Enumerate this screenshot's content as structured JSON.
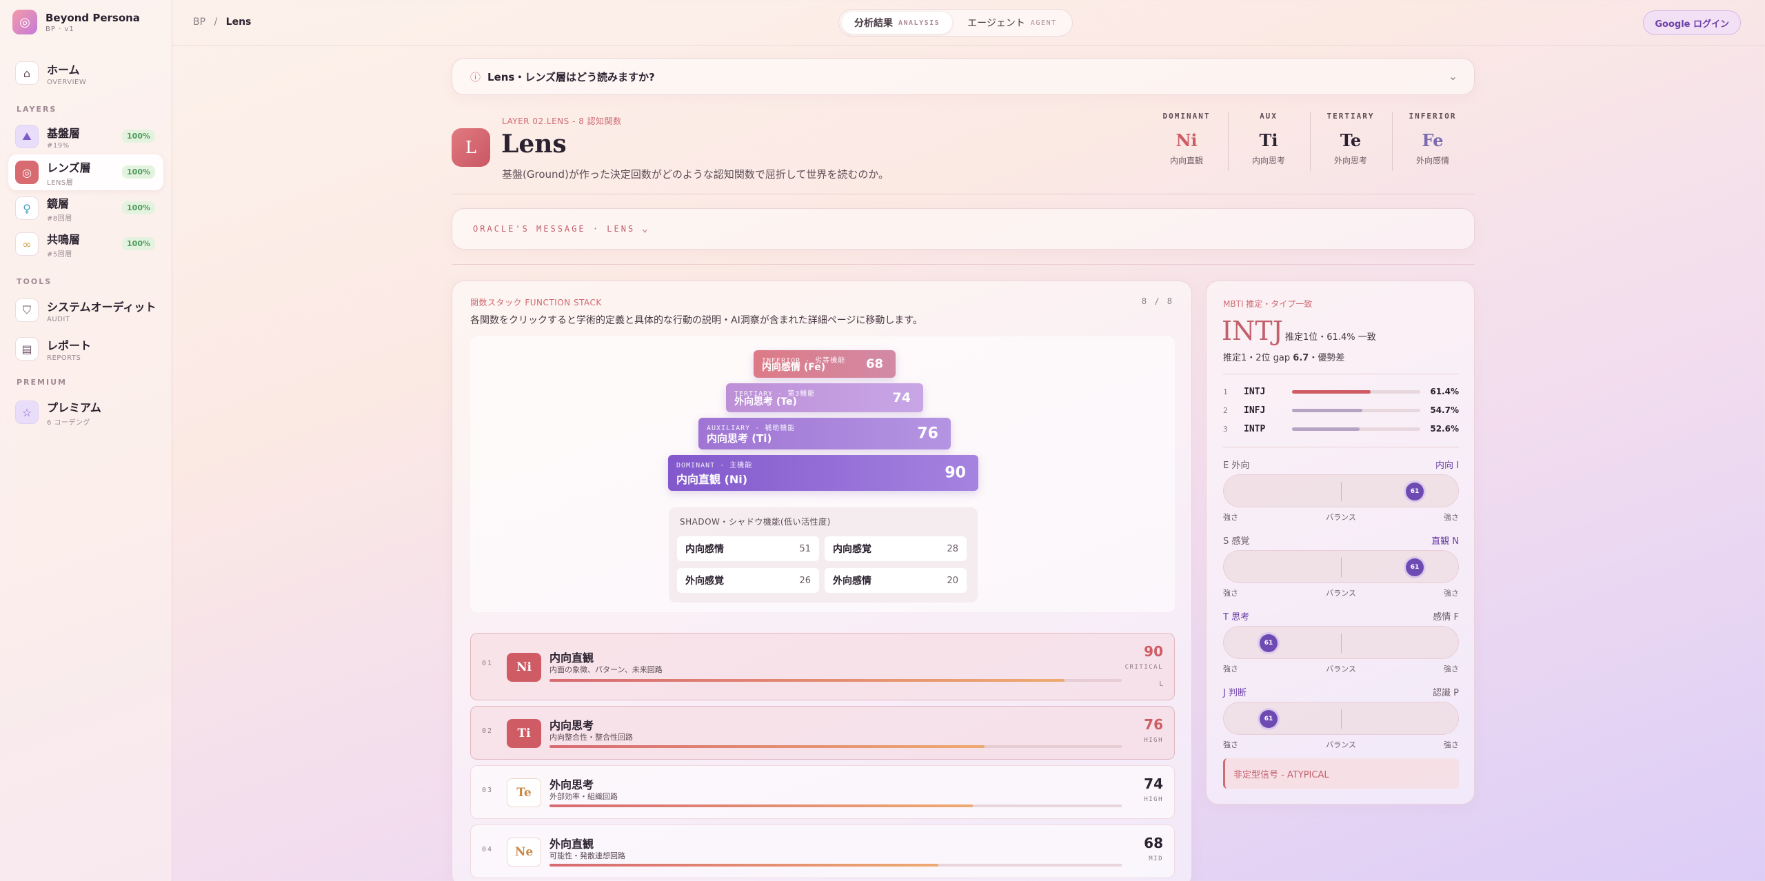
{
  "brand": {
    "name": "Beyond Persona",
    "sub": "BP · v1"
  },
  "breadcrumb": {
    "root": "BP",
    "sep": "/",
    "current": "Lens"
  },
  "segmented": [
    {
      "label": "分析結果",
      "en": "ANALYSIS"
    },
    {
      "label": "エージェント",
      "en": "AGENT"
    }
  ],
  "login_label": "Google ログイン",
  "sidebar": {
    "home": {
      "label": "ホーム",
      "sub": "OVERVIEW"
    },
    "layers_label": "LAYERS",
    "layers": [
      {
        "label": "基盤層",
        "sub": "#19%",
        "pct": "100%"
      },
      {
        "label": "レンズ層",
        "sub": "LENS層",
        "pct": "100%"
      },
      {
        "label": "鏡層",
        "sub": "#8回層",
        "pct": "100%"
      },
      {
        "label": "共鳴層",
        "sub": "#5回層",
        "pct": "100%"
      }
    ],
    "tools_label": "TOOLS",
    "tools": [
      {
        "label": "システムオーディット",
        "sub": "AUDIT"
      },
      {
        "label": "レポート",
        "sub": "REPORTS"
      }
    ],
    "premium_label": "PREMIUM",
    "premium": {
      "label": "プレミアム",
      "sub": "6 コーデング"
    }
  },
  "info_question": "Lens・レンズ層はどう読みますか?",
  "header": {
    "layer_label": "LAYER 02.LENS - 8 認知関数",
    "badge": "L",
    "title": "Lens",
    "desc": "基盤(Ground)が作った決定回数がどのような認知関数で屈折して世界を読むのか。",
    "stack": [
      {
        "role": "DOMINANT",
        "code": "Ni",
        "jp": "内向直観",
        "color": "#cf5c64"
      },
      {
        "role": "AUX",
        "code": "Ti",
        "jp": "内向思考",
        "color": "#2b2230"
      },
      {
        "role": "TERTIARY",
        "code": "Te",
        "jp": "外向思考",
        "color": "#2b2230"
      },
      {
        "role": "INFERIOR",
        "code": "Fe",
        "jp": "外向感情",
        "color": "#7b6bb0"
      }
    ]
  },
  "oracle_label": "ORACLE'S MESSAGE · LENS",
  "function_stack": {
    "title": "関数スタック FUNCTION STACK",
    "subtitle": "各関数をクリックすると学術的定義と具体的な行動の説明・AI洞察が含まれた詳細ページに移動します。",
    "count": "8 / 8",
    "pyramid": [
      {
        "role": "INFERIOR · 劣等機能",
        "name": "内向感情 (Fe)",
        "value": 68
      },
      {
        "role": "TERTIARY · 第3機能",
        "name": "外向思考 (Te)",
        "value": 74
      },
      {
        "role": "AUXILIARY · 補助機能",
        "name": "内向思考 (Ti)",
        "value": 76
      },
      {
        "role": "DOMINANT · 主機能",
        "name": "内向直観 (Ni)",
        "value": 90
      }
    ],
    "shadow": {
      "title": "SHADOW・シャドウ機能(低い活性度)",
      "cells": [
        {
          "label": "内向感情",
          "value": "51"
        },
        {
          "label": "内向感覚",
          "value": "28"
        },
        {
          "label": "外向感覚",
          "value": "26"
        },
        {
          "label": "外向感情",
          "value": "20"
        }
      ]
    },
    "rows": [
      {
        "idx": "01",
        "code": "Ni",
        "name": "内向直観",
        "desc": "内面の象徴、パターン、未来回路",
        "score": "90",
        "level": "CRITICAL",
        "end": "L",
        "fill": 0.9
      },
      {
        "idx": "02",
        "code": "Ti",
        "name": "内向思考",
        "desc": "内向整合性・整合性回路",
        "score": "76",
        "level": "HIGH",
        "fill": 0.76
      },
      {
        "idx": "03",
        "code": "Te",
        "name": "外向思考",
        "desc": "外部効率・組織回路",
        "score": "74",
        "level": "HIGH",
        "fill": 0.74
      },
      {
        "idx": "04",
        "code": "Ne",
        "name": "外向直観",
        "desc": "可能性・発散連想回路",
        "score": "68",
        "level": "MID",
        "fill": 0.68
      }
    ]
  },
  "mbti": {
    "label": "MBTI 推定・タイプ一致",
    "type": "INTJ",
    "rank": "推定1位・61.4% 一致",
    "gap_prefix": "推定1・2位 gap ",
    "gap_value": "6.7",
    "gap_suffix": "・優勢差",
    "candidates": [
      {
        "no": "1",
        "name": "INTJ",
        "pct": "61.4%",
        "fill": 0.614,
        "color": "#cf5c64"
      },
      {
        "no": "2",
        "name": "INFJ",
        "pct": "54.7%",
        "fill": 0.547,
        "color": "#b5a4c4"
      },
      {
        "no": "3",
        "name": "INTP",
        "pct": "52.6%",
        "fill": 0.526,
        "color": "#b5a4c4"
      }
    ],
    "axes": [
      {
        "left": "E 外向",
        "right": "内向 I",
        "dot": "61",
        "position": 0.81
      },
      {
        "left": "S 感覚",
        "right": "直観 N",
        "dot": "61",
        "position": 0.81
      },
      {
        "left": "T 思考",
        "right": "感情 F",
        "dot": "61",
        "position": 0.19
      },
      {
        "left": "J 判断",
        "right": "認識 P",
        "dot": "61",
        "position": 0.19
      }
    ],
    "axis_bottom": {
      "left": "強さ",
      "mid": "バランス",
      "right": "強さ"
    },
    "atypical": "非定型信号 - ATYPICAL"
  }
}
